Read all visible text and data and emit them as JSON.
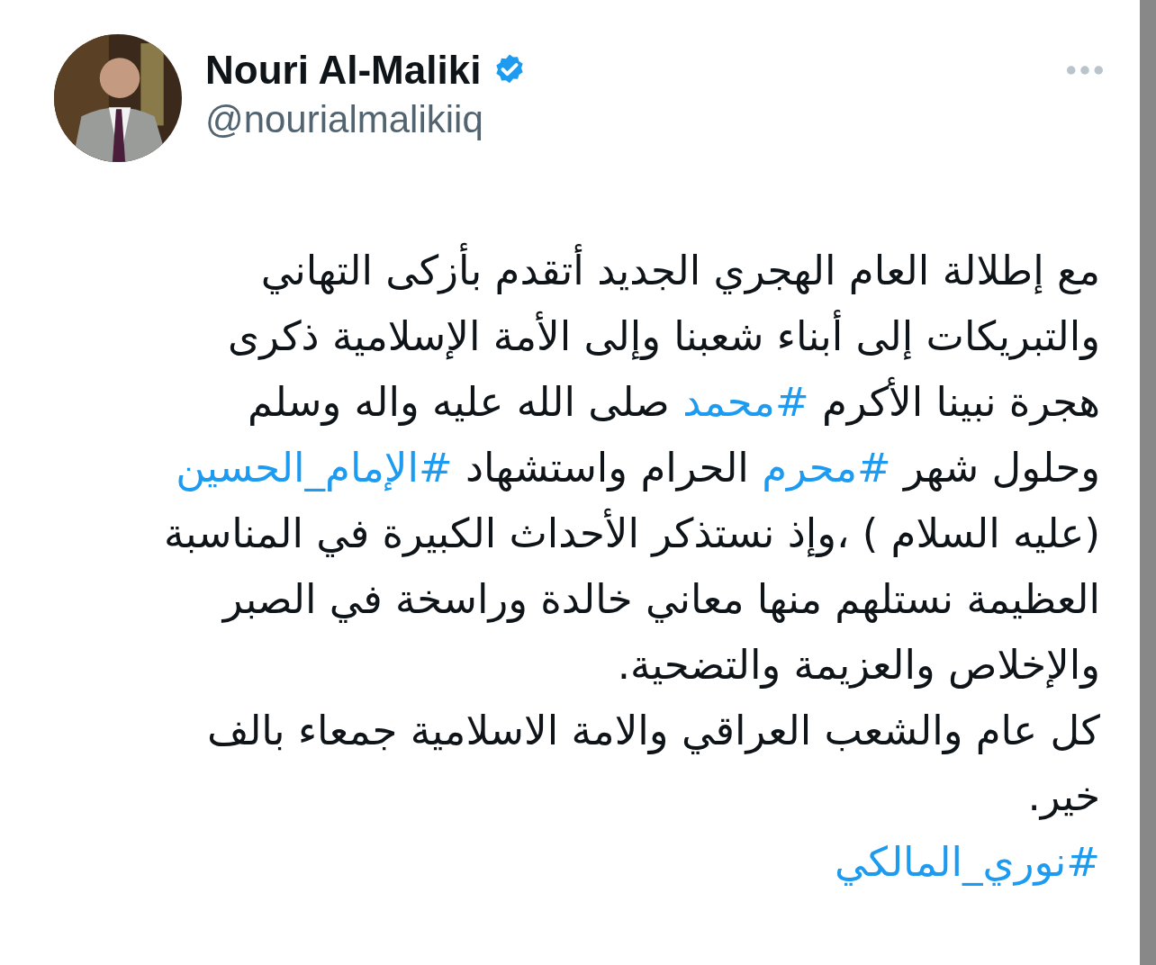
{
  "author": {
    "name": "Nouri Al-Maliki",
    "verified": true,
    "handle": "@nourialmalikiiq"
  },
  "tweet": {
    "lines": [
      [
        {
          "kind": "text",
          "text": "مع إطلالة العام الهجري الجديد أتقدم بأزكى التهاني"
        }
      ],
      [
        {
          "kind": "text",
          "text": "والتبريكات إلى أبناء شعبنا وإلى الأمة الإسلامية ذكرى"
        }
      ],
      [
        {
          "kind": "text",
          "text": "هجرة نبينا الأكرم "
        },
        {
          "kind": "hashtag",
          "text": "#محمد"
        },
        {
          "kind": "text",
          "text": " صلى الله عليه واله وسلم"
        }
      ],
      [
        {
          "kind": "text",
          "text": "وحلول شهر "
        },
        {
          "kind": "hashtag",
          "text": "#محرم"
        },
        {
          "kind": "text",
          "text": " الحرام واستشهاد "
        },
        {
          "kind": "hashtag",
          "text": "#الإمام_الحسين"
        }
      ],
      [
        {
          "kind": "text",
          "text": "(عليه السلام ) ،وإذ نستذكر الأحداث الكبيرة في المناسبة"
        }
      ],
      [
        {
          "kind": "text",
          "text": "العظيمة نستلهم منها معاني خالدة وراسخة في الصبر"
        }
      ],
      [
        {
          "kind": "text",
          "text": "والإخلاص والعزيمة والتضحية."
        }
      ],
      [
        {
          "kind": "text",
          "text": "كل عام والشعب العراقي والامة الاسلامية جمعاء  بالف"
        }
      ],
      [
        {
          "kind": "text",
          "text": "خير."
        }
      ],
      [
        {
          "kind": "hashtag",
          "text": "#نوري_المالكي"
        }
      ]
    ]
  }
}
